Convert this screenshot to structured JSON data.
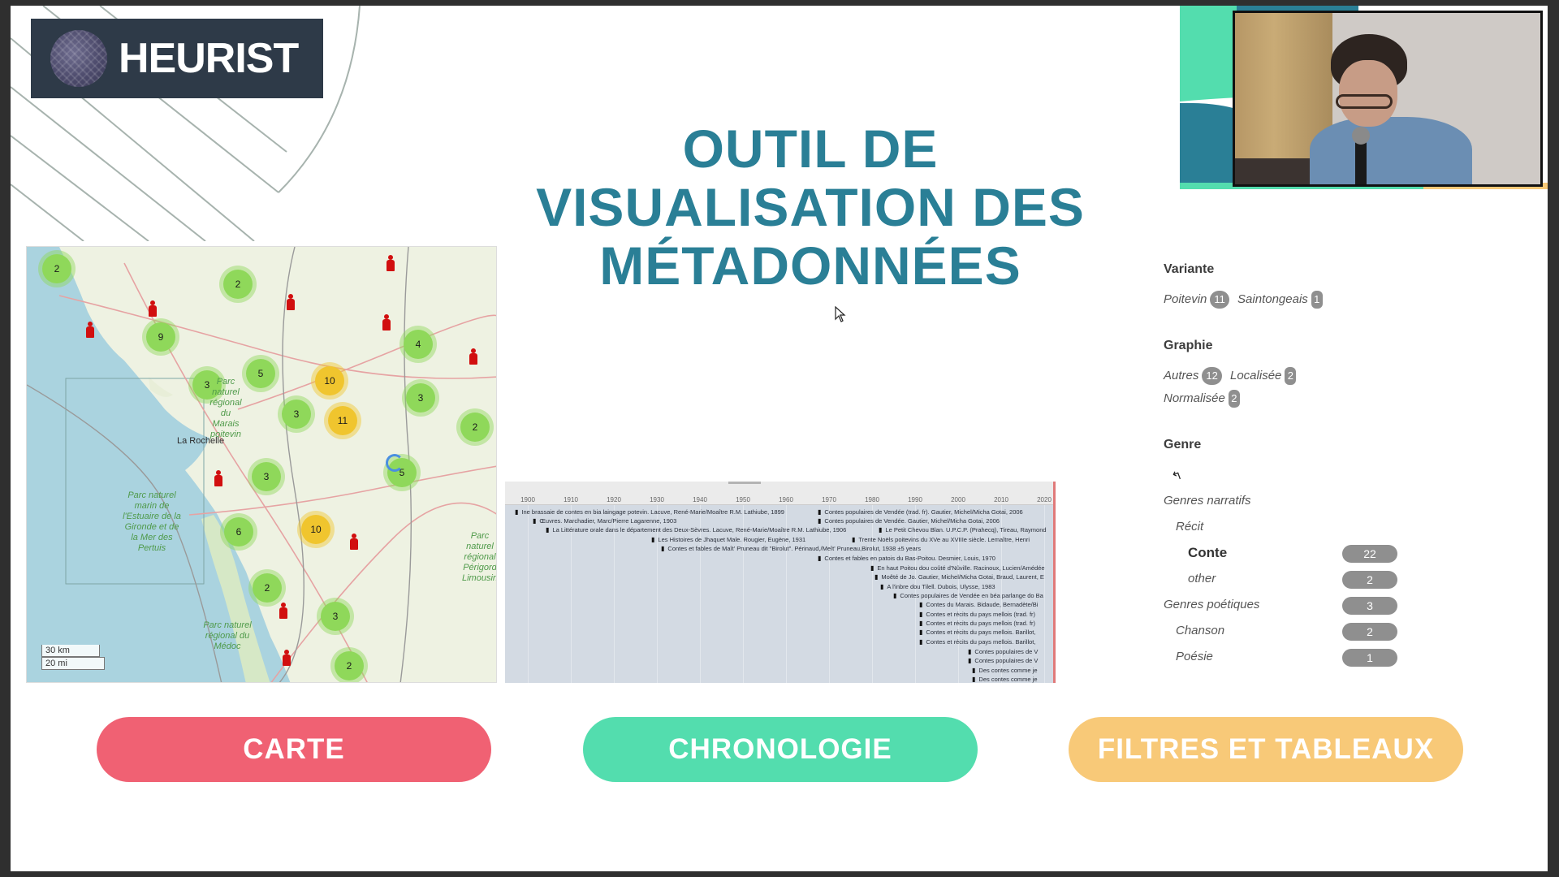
{
  "logo": {
    "text": "HEURIST"
  },
  "title": {
    "lines": [
      "OUTIL DE",
      "VISUALISATION DES",
      "MÉTADONNÉES"
    ]
  },
  "colors": {
    "title": "#2a7f96",
    "carte": "#f06173",
    "chronologie": "#53ddae",
    "filtres": "#f8c978",
    "cluster_small": "#8fd85a",
    "cluster_medium": "#f0c52e",
    "marker": "#d10f0f",
    "badge": "#8f8f8f"
  },
  "map": {
    "clusters": [
      {
        "count": "2",
        "size": "small"
      },
      {
        "count": "2",
        "size": "small"
      },
      {
        "count": "9",
        "size": "small"
      },
      {
        "count": "4",
        "size": "small"
      },
      {
        "count": "3",
        "size": "small"
      },
      {
        "count": "5",
        "size": "small"
      },
      {
        "count": "10",
        "size": "medium"
      },
      {
        "count": "3",
        "size": "small"
      },
      {
        "count": "3",
        "size": "small"
      },
      {
        "count": "11",
        "size": "medium"
      },
      {
        "count": "2",
        "size": "small"
      },
      {
        "count": "3",
        "size": "small"
      },
      {
        "count": "5",
        "size": "small"
      },
      {
        "count": "6",
        "size": "small"
      },
      {
        "count": "10",
        "size": "medium"
      },
      {
        "count": "2",
        "size": "small"
      },
      {
        "count": "3",
        "size": "small"
      },
      {
        "count": "2",
        "size": "small"
      }
    ],
    "place_labels": [
      "La Rochelle"
    ],
    "park_labels": [
      "Parc naturel marin de l'Estuaire de la Gironde et de la Mer des Pertuis",
      "Parc naturel régional du Médoc",
      "Parc naturel régional Périgord Limousin",
      "Parc naturel régional du Marais poitevin"
    ],
    "scale": {
      "km": "30 km",
      "mi": "20 mi"
    }
  },
  "timeline": {
    "ticks": [
      "1900",
      "1910",
      "1920",
      "1930",
      "1940",
      "1950",
      "1960",
      "1970",
      "1980",
      "1990",
      "2000",
      "2010",
      "2020"
    ],
    "events": [
      "Ine brassaie de contes en bia laingage potevin. Lacuve, René-Marie/Moaître R.M. Lathiube, 1899",
      "Contes populaires de Vendée (trad. fr). Gautier, Michel/Micha Gotai, 2006",
      "Contes populaires de Vendée. Gautier, Michel/Micha Gotai, 2006",
      "Œuvres. Marchadier, Marc/Pierre Lagarenne, 1903",
      "La Littérature orale dans le département des Deux-Sèvres. Lacuve, René-Marie/Moaître R.M. Lathiube, 1906",
      "Le Petit Chevou Blan. U.P.C.P. (Prahecq), Tireau, Raymond",
      "Les Histoires de Jhaquet Male. Rougier, Eugène, 1931",
      "Trente Noëls poitevins du XVe au XVIIIe siècle. Lemaître, Henri",
      "Contes et fables de Maît' Pruneau dit \"Birolut\". Périnaud,/Meît' Pruneau,Birolut, 1938 ±5 years",
      "Contes et fables en patois du Bas-Poitou. Desmier, Louis, 1970",
      "En haut Poitou dou coûté d'Nûville. Racinoux, Lucien/Amédée",
      "Moêté de Jo. Gautier, Michel/Micha Gotai, Braud, Laurent, E",
      "A l'inbre dou Tilell. Dubois, Ulysse, 1983",
      "Contes populaires de Vendée en béa parlange do Ba",
      "Contes du Marais. Bidaude, Bernadète/Bi",
      "Contes et récits du pays mellois (trad. fr)",
      "Contes et récits du pays mellois (trad. fr)",
      "Contes et récits du pays mellois. Barillot,",
      "Contes et récits du pays mellois. Barillot,",
      "Contes populaires de V",
      "Contes populaires de V",
      "Des contes comme je",
      "Des contes comme je"
    ]
  },
  "facets": {
    "variante": {
      "title": "Variante",
      "items": [
        {
          "label": "Poitevin",
          "count": "11"
        },
        {
          "label": "Saintongeais",
          "count": "1"
        }
      ]
    },
    "graphie": {
      "title": "Graphie",
      "items": [
        {
          "label": "Autres",
          "count": "12"
        },
        {
          "label": "Localisée",
          "count": "2"
        },
        {
          "label": "Normalisée",
          "count": "2"
        }
      ]
    },
    "genre": {
      "title": "Genre",
      "back_icon": "back-arrow-icon",
      "tree": [
        {
          "label": "Genres narratifs",
          "count": null,
          "level": 0
        },
        {
          "label": "Récit",
          "count": null,
          "level": 1
        },
        {
          "label": "Conte",
          "count": "22",
          "level": 2,
          "selected": true
        },
        {
          "label": "other",
          "count": "2",
          "level": 2
        },
        {
          "label": "Genres poétiques",
          "count": "3",
          "level": 0
        },
        {
          "label": "Chanson",
          "count": "2",
          "level": 1
        },
        {
          "label": "Poésie",
          "count": "1",
          "level": 1
        }
      ]
    }
  },
  "buttons": {
    "carte": "CARTE",
    "chronologie": "CHRONOLOGIE",
    "filtres": "FILTRES ET TABLEAUX"
  }
}
